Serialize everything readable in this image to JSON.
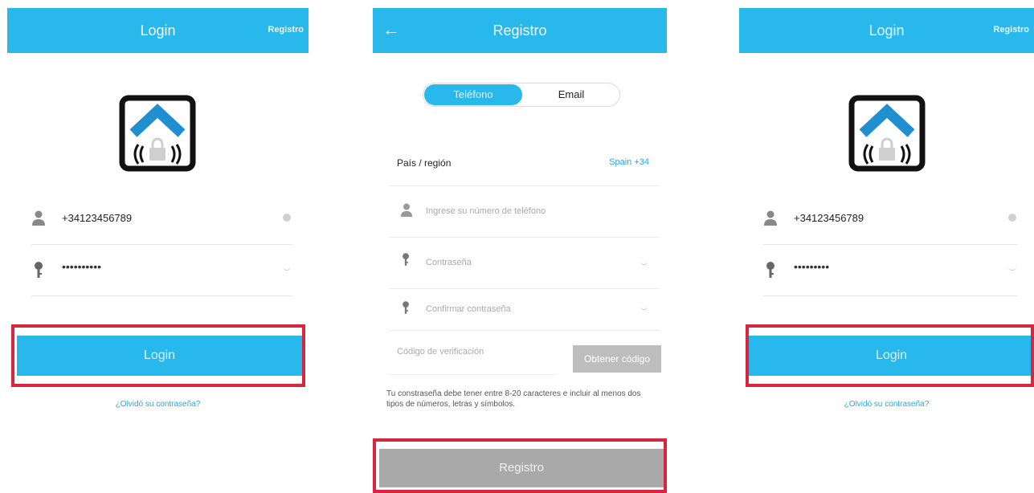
{
  "login_screen_1": {
    "title": "Login",
    "register_link": "Registro",
    "phone_value": "+34123456789",
    "password_value": "••••••••••",
    "login_button": "Login",
    "forgot_link": "¿Olvidó su contraseña?"
  },
  "register_screen": {
    "title": "Registro",
    "tabs": [
      "Teléfono",
      "Email"
    ],
    "country_label": "País / región",
    "country_value": "Spain +34",
    "phone_placeholder": "Ingrese su número de teléfono",
    "password_placeholder": "Contraseña",
    "confirm_placeholder": "Confirmar contraseña",
    "code_placeholder": "Código de verificación",
    "get_code_button": "Obtener código",
    "hint": "Tu constraseña debe tener entre 8-20 caracteres e incluir al menos dos tipos de números, letras y símbolos.",
    "register_button": "Registro"
  },
  "login_screen_2": {
    "title": "Login",
    "register_link": "Registro",
    "phone_value": "+34123456789",
    "password_value": "•••••••••",
    "login_button": "Login",
    "forgot_link": "¿Olvidó su contraseña?"
  },
  "colors": {
    "header": "#29b8ec",
    "highlight": "#d7263d",
    "disabled_button": "#a9a9a9"
  }
}
